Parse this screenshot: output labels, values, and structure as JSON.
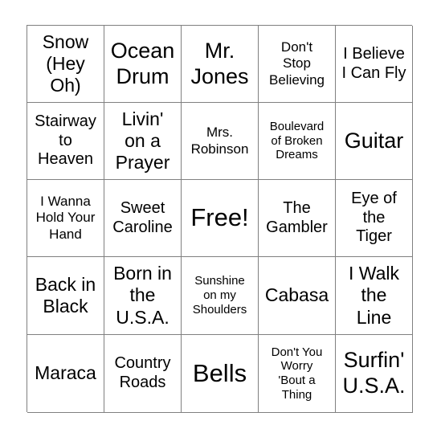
{
  "card": {
    "type": "bingo-card",
    "rows": 5,
    "columns": 5,
    "border_color": "#808080",
    "background_color": "#ffffff",
    "text_color": "#000000",
    "cells": [
      [
        {
          "text": "Snow\n(Hey\nOh)",
          "size": "lg"
        },
        {
          "text": "Ocean\nDrum",
          "size": "xl"
        },
        {
          "text": "Mr.\nJones",
          "size": "xl"
        },
        {
          "text": "Don't\nStop\nBelieving",
          "size": "sm"
        },
        {
          "text": "I Believe\nI Can Fly",
          "size": "md"
        }
      ],
      [
        {
          "text": "Stairway\nto\nHeaven",
          "size": "md"
        },
        {
          "text": "Livin'\non a\nPrayer",
          "size": "lg"
        },
        {
          "text": "Mrs.\nRobinson",
          "size": "sm"
        },
        {
          "text": "Boulevard\nof Broken\nDreams",
          "size": "xs"
        },
        {
          "text": "Guitar",
          "size": "xl"
        }
      ],
      [
        {
          "text": "I Wanna\nHold Your\nHand",
          "size": "sm"
        },
        {
          "text": "Sweet\nCaroline",
          "size": "md"
        },
        {
          "text": "Free!",
          "size": "xxl"
        },
        {
          "text": "The\nGambler",
          "size": "md"
        },
        {
          "text": "Eye of\nthe\nTiger",
          "size": "md"
        }
      ],
      [
        {
          "text": "Back in\nBlack",
          "size": "lg"
        },
        {
          "text": "Born in\nthe\nU.S.A.",
          "size": "lg"
        },
        {
          "text": "Sunshine\non my\nShoulders",
          "size": "xs"
        },
        {
          "text": "Cabasa",
          "size": "lg"
        },
        {
          "text": "I Walk\nthe\nLine",
          "size": "lg"
        }
      ],
      [
        {
          "text": "Maraca",
          "size": "lg"
        },
        {
          "text": "Country\nRoads",
          "size": "md"
        },
        {
          "text": "Bells",
          "size": "xxl"
        },
        {
          "text": "Don't You\nWorry\n'Bout a\nThing",
          "size": "xs"
        },
        {
          "text": "Surfin'\nU.S.A.",
          "size": "xl"
        }
      ]
    ]
  }
}
